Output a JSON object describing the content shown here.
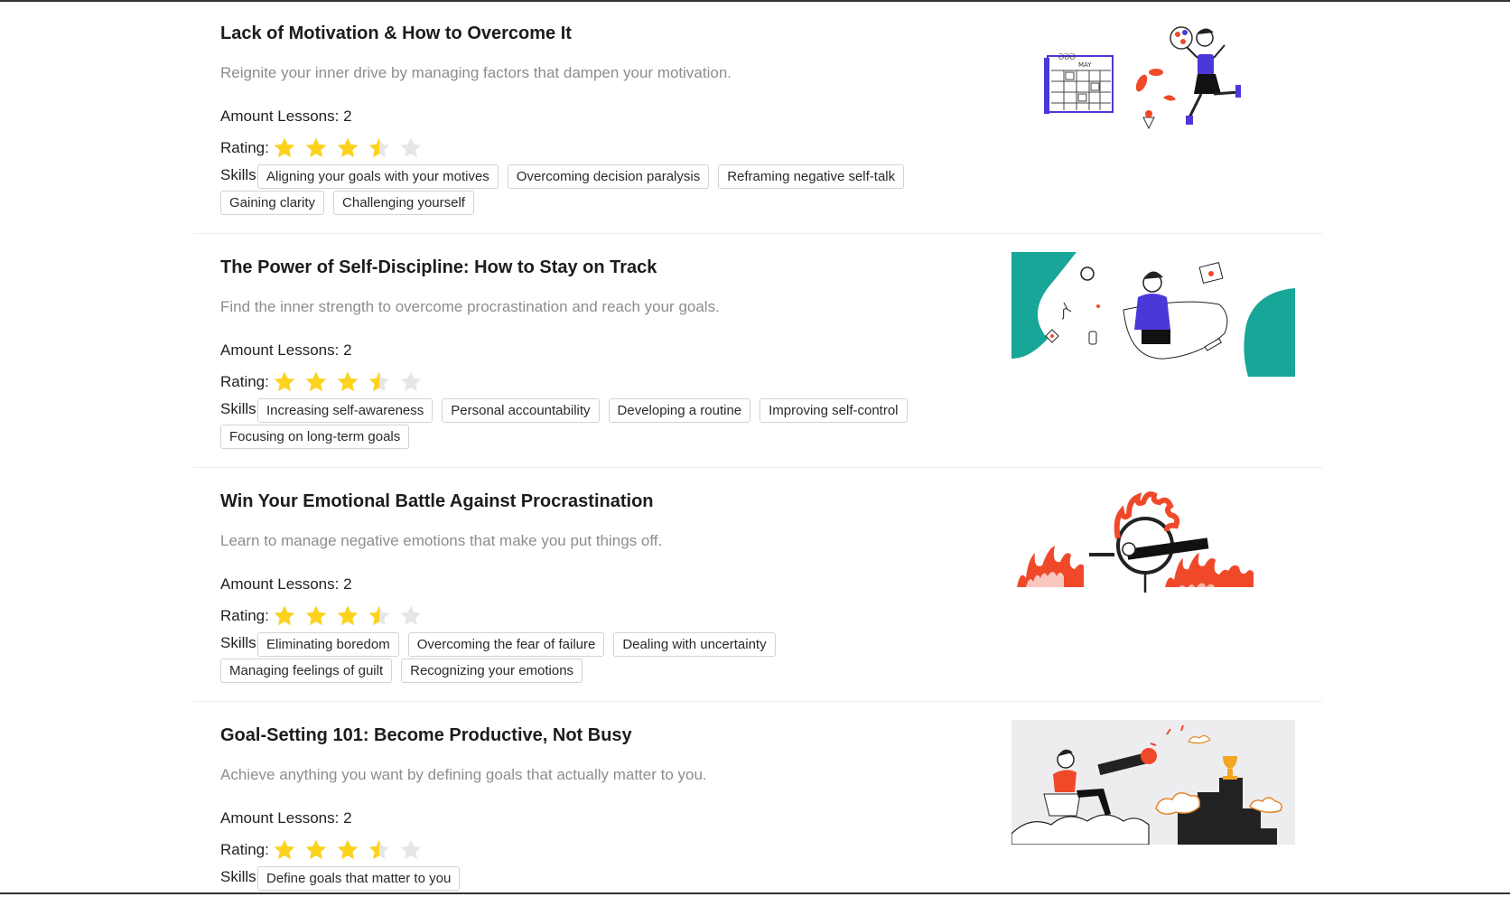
{
  "labels": {
    "lessons_prefix": "Amount Lessons: ",
    "rating": "Rating:",
    "skills": "Skills:"
  },
  "colors": {
    "star_filled": "#fcd21c",
    "star_empty": "#e6e6e6",
    "teal": "#17a697",
    "orange": "#f0492a",
    "purple": "#4b38d8"
  },
  "courses": [
    {
      "title": "Lack of Motivation & How to Overcome It",
      "description": "Reignite your inner drive by managing factors that dampen your motivation.",
      "lessons": "Amount Lessons: 2",
      "rating": 3.5,
      "skills": [
        "Aligning your goals with your motives",
        "Overcoming decision paralysis",
        "Reframing negative self-talk",
        "Gaining clarity",
        "Challenging yourself"
      ],
      "image": "motivation-illustration"
    },
    {
      "title": "The Power of Self-Discipline: How to Stay on Track",
      "description": "Find the inner strength to overcome procrastination and reach your goals.",
      "lessons": "Amount Lessons: 2",
      "rating": 3.5,
      "skills": [
        "Increasing self-awareness",
        "Personal accountability",
        "Developing a routine",
        "Improving self-control",
        "Focusing on long-term goals"
      ],
      "image": "self-discipline-illustration"
    },
    {
      "title": "Win Your Emotional Battle Against Procrastination",
      "description": "Learn to manage negative emotions that make you put things off.",
      "lessons": "Amount Lessons: 2",
      "rating": 3.5,
      "skills": [
        "Eliminating boredom",
        "Overcoming the fear of failure",
        "Dealing with uncertainty",
        "Managing feelings of guilt",
        "Recognizing your emotions"
      ],
      "image": "fire-hoop-illustration"
    },
    {
      "title": "Goal-Setting 101: Become Productive, Not Busy",
      "description": "Achieve anything you want by defining goals that actually matter to you.",
      "lessons": "Amount Lessons: 2",
      "rating": 3.5,
      "skills": [
        "Define goals that matter to you"
      ],
      "image": "telescope-trophy-illustration"
    }
  ]
}
